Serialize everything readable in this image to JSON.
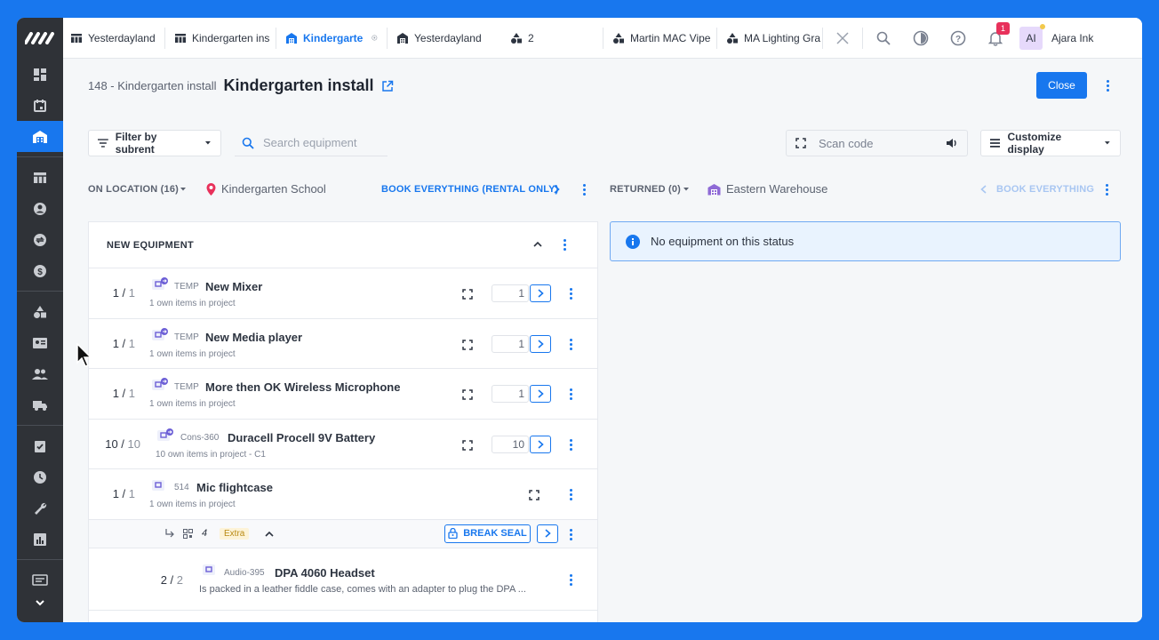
{
  "tabs": [
    {
      "label": "Yesterdayland",
      "icon": "table-icon"
    },
    {
      "label": "Kindergarten ins",
      "icon": "table-icon"
    },
    {
      "label": "Kindergarte",
      "icon": "warehouse-icon",
      "active": true
    },
    {
      "label": "Yesterdayland",
      "icon": "warehouse-icon"
    },
    {
      "label": "2",
      "icon": "shapes-icon"
    },
    {
      "label": "Martin MAC Vipe",
      "icon": "shapes-icon"
    },
    {
      "label": "MA Lighting Grar",
      "icon": "shapes-icon"
    }
  ],
  "topbar": {
    "notification_count": "1",
    "avatar_initials": "AI",
    "user_name": "Ajara Ink"
  },
  "header": {
    "crumb": "148 - Kindergarten install",
    "title": "Kindergarten install",
    "close_label": "Close"
  },
  "toolbar": {
    "filter_label": "Filter by subrent",
    "search_placeholder": "Search equipment",
    "scan_placeholder": "Scan code",
    "customize_label": "Customize display"
  },
  "status_left": {
    "label": "ON LOCATION (16)",
    "location": "Kindergarten School",
    "action": "BOOK EVERYTHING (RENTAL ONLY)"
  },
  "status_right": {
    "label": "RETURNED (0)",
    "location": "Eastern Warehouse",
    "action": "BOOK EVERYTHING"
  },
  "panel": {
    "title": "NEW EQUIPMENT",
    "rows": [
      {
        "qty": "1",
        "total": "1",
        "code": "TEMP",
        "name": "New Mixer",
        "sub": "1 own items in project",
        "count": "1"
      },
      {
        "qty": "1",
        "total": "1",
        "code": "TEMP",
        "name": "New Media player",
        "sub": "1 own items in project",
        "count": "1"
      },
      {
        "qty": "1",
        "total": "1",
        "code": "TEMP",
        "name": "More then OK Wireless Microphone",
        "sub": "1 own items in project",
        "count": "1"
      },
      {
        "qty": "10",
        "total": "10",
        "code": "Cons-360",
        "name": "Duracell Procell 9V Battery",
        "sub": "10 own items in project - C1",
        "count": "10"
      },
      {
        "qty": "1",
        "total": "1",
        "code": "514",
        "name": "Mic flightcase",
        "sub": "1 own items in project"
      }
    ],
    "subrow": {
      "count": "4",
      "tag": "Extra",
      "break_seal": "BREAK SEAL"
    },
    "child": {
      "qty": "2",
      "total": "2",
      "code": "Audio-395",
      "name": "DPA 4060 Headset",
      "sub": "Is packed in a leather fiddle case, comes with an adapter to plug the DPA ..."
    }
  },
  "empty_state": "No equipment on this status",
  "colors": {
    "brand": "#1877ee",
    "rail": "#2f3237",
    "badge": "#e8315b"
  }
}
